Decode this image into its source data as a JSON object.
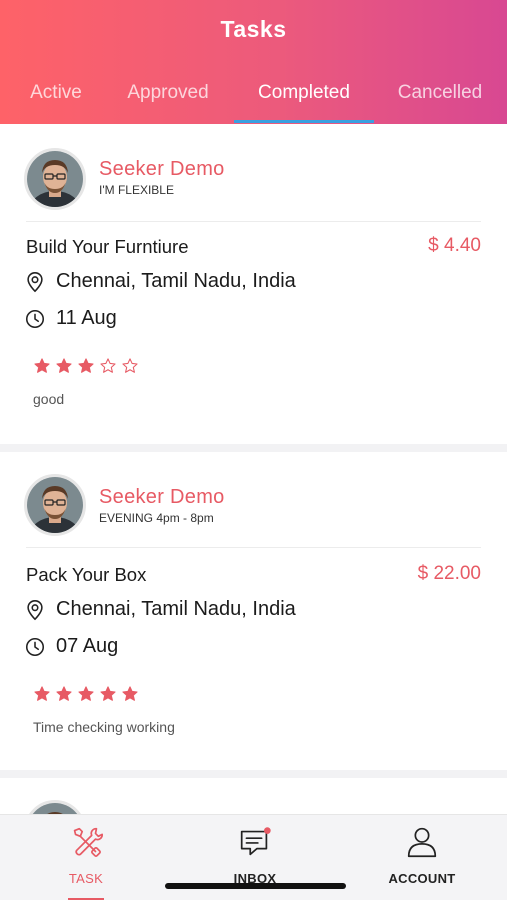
{
  "header": {
    "title": "Tasks",
    "tabs": [
      {
        "label": "Active"
      },
      {
        "label": "Approved"
      },
      {
        "label": "Completed"
      },
      {
        "label": "Cancelled"
      }
    ],
    "active_tab": "Completed"
  },
  "tasks": [
    {
      "seeker_name": "Seeker Demo",
      "slot": "I'M FLEXIBLE",
      "title": "Build Your Furntiure",
      "price": "$ 4.40",
      "location": "Chennai, Tamil Nadu, India",
      "date": "11 Aug",
      "rating": 3,
      "rating_max": 5,
      "review": "good"
    },
    {
      "seeker_name": "Seeker Demo",
      "slot": "EVENING 4pm - 8pm",
      "title": "Pack Your Box",
      "price": "$ 22.00",
      "location": "Chennai, Tamil Nadu, India",
      "date": "07 Aug",
      "rating": 5,
      "rating_max": 5,
      "review": "Time checking working"
    }
  ],
  "bottom_nav": {
    "items": [
      {
        "label": "TASK",
        "icon": "tools-icon"
      },
      {
        "label": "INBOX",
        "icon": "chat-icon"
      },
      {
        "label": "ACCOUNT",
        "icon": "person-icon"
      }
    ],
    "active": "TASK"
  },
  "colors": {
    "accent": "#e75a64",
    "header_start": "#fe6268",
    "header_end": "#d84892",
    "tab_underline": "#3aa0e0"
  }
}
